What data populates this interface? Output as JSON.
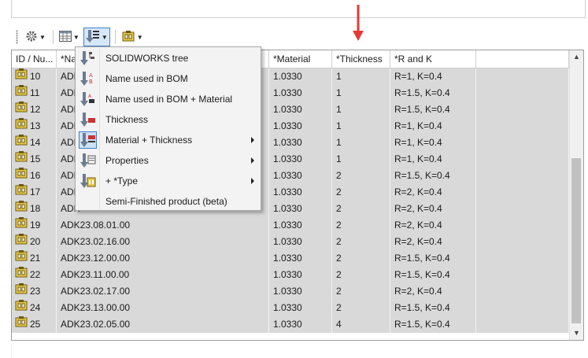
{
  "columns": [
    {
      "key": "id",
      "label": "ID / Nu...",
      "w": 57
    },
    {
      "key": "name",
      "label": "*Na",
      "w": 270
    },
    {
      "key": "material",
      "label": "*Material",
      "w": 80
    },
    {
      "key": "thickness",
      "label": "*Thickness",
      "w": 74
    },
    {
      "key": "rk",
      "label": "*R and K",
      "w": 109
    },
    {
      "key": "extra",
      "label": "",
      "w": 118
    }
  ],
  "rows": [
    {
      "id": "10",
      "name": "ADK",
      "material": "1.0330",
      "thickness": "1",
      "rk": "R=1, K=0.4"
    },
    {
      "id": "11",
      "name": "ADK",
      "material": "1.0330",
      "thickness": "1",
      "rk": "R=1.5, K=0.4"
    },
    {
      "id": "12",
      "name": "ADK",
      "material": "1.0330",
      "thickness": "1",
      "rk": "R=1.5, K=0.4"
    },
    {
      "id": "13",
      "name": "ADK",
      "material": "1.0330",
      "thickness": "1",
      "rk": "R=1, K=0.4"
    },
    {
      "id": "14",
      "name": "ADK",
      "material": "1.0330",
      "thickness": "1",
      "rk": "R=1, K=0.4"
    },
    {
      "id": "15",
      "name": "ADK",
      "material": "1.0330",
      "thickness": "1",
      "rk": "R=1, K=0.4"
    },
    {
      "id": "16",
      "name": "ADK",
      "material": "1.0330",
      "thickness": "2",
      "rk": "R=1.5, K=0.4"
    },
    {
      "id": "17",
      "name": "ADK",
      "material": "1.0330",
      "thickness": "2",
      "rk": "R=2, K=0.4"
    },
    {
      "id": "18",
      "name": "ADK",
      "material": "1.0330",
      "thickness": "2",
      "rk": "R=2, K=0.4"
    },
    {
      "id": "19",
      "name": "ADK23.08.01.00",
      "material": "1.0330",
      "thickness": "2",
      "rk": "R=2, K=0.4"
    },
    {
      "id": "20",
      "name": "ADK23.02.16.00",
      "material": "1.0330",
      "thickness": "2",
      "rk": "R=2, K=0.4"
    },
    {
      "id": "21",
      "name": "ADK23.12.00.00",
      "material": "1.0330",
      "thickness": "2",
      "rk": "R=1.5, K=0.4"
    },
    {
      "id": "22",
      "name": "ADK23.11.00.00",
      "material": "1.0330",
      "thickness": "2",
      "rk": "R=1.5, K=0.4"
    },
    {
      "id": "23",
      "name": "ADK23.02.17.00",
      "material": "1.0330",
      "thickness": "2",
      "rk": "R=2, K=0.4"
    },
    {
      "id": "24",
      "name": "ADK23.13.00.00",
      "material": "1.0330",
      "thickness": "2",
      "rk": "R=1.5, K=0.4"
    },
    {
      "id": "25",
      "name": "ADK23.02.05.00",
      "material": "1.0330",
      "thickness": "4",
      "rk": "R=1.5, K=0.4"
    }
  ],
  "menu": {
    "items": [
      {
        "label": "SOLIDWORKS tree",
        "icon": "tree-sort-icon",
        "submenu": false,
        "highlight": false
      },
      {
        "label": "Name used in BOM",
        "icon": "name-sort-icon",
        "submenu": false,
        "highlight": false
      },
      {
        "label": "Name used in BOM + Material",
        "icon": "name-material-sort-icon",
        "submenu": false,
        "highlight": false
      },
      {
        "label": "Thickness",
        "icon": "thickness-sort-icon",
        "submenu": false,
        "highlight": false
      },
      {
        "label": "Material + Thickness",
        "icon": "material-thickness-sort-icon",
        "submenu": true,
        "highlight": true
      },
      {
        "label": "Properties",
        "icon": "properties-sort-icon",
        "submenu": true,
        "highlight": false
      },
      {
        "label": "+ *Type",
        "icon": "type-sort-icon",
        "submenu": true,
        "highlight": false
      },
      {
        "label": "Semi-Finished product (beta)",
        "icon": "",
        "submenu": false,
        "highlight": false
      }
    ]
  },
  "toolbar": {
    "buttons": [
      {
        "name": "settings-button",
        "icon": "gear-icon"
      },
      {
        "name": "table-view-button",
        "icon": "table-icon"
      },
      {
        "name": "sort-mode-button",
        "icon": "sort-icon",
        "active": true
      },
      {
        "name": "part-options-button",
        "icon": "part-icon"
      }
    ]
  },
  "colors": {
    "row_bg": "#d9d9d9",
    "accent": "#3e7fc7",
    "arrow": "#e53935",
    "icon_gold": "#c8a317"
  }
}
